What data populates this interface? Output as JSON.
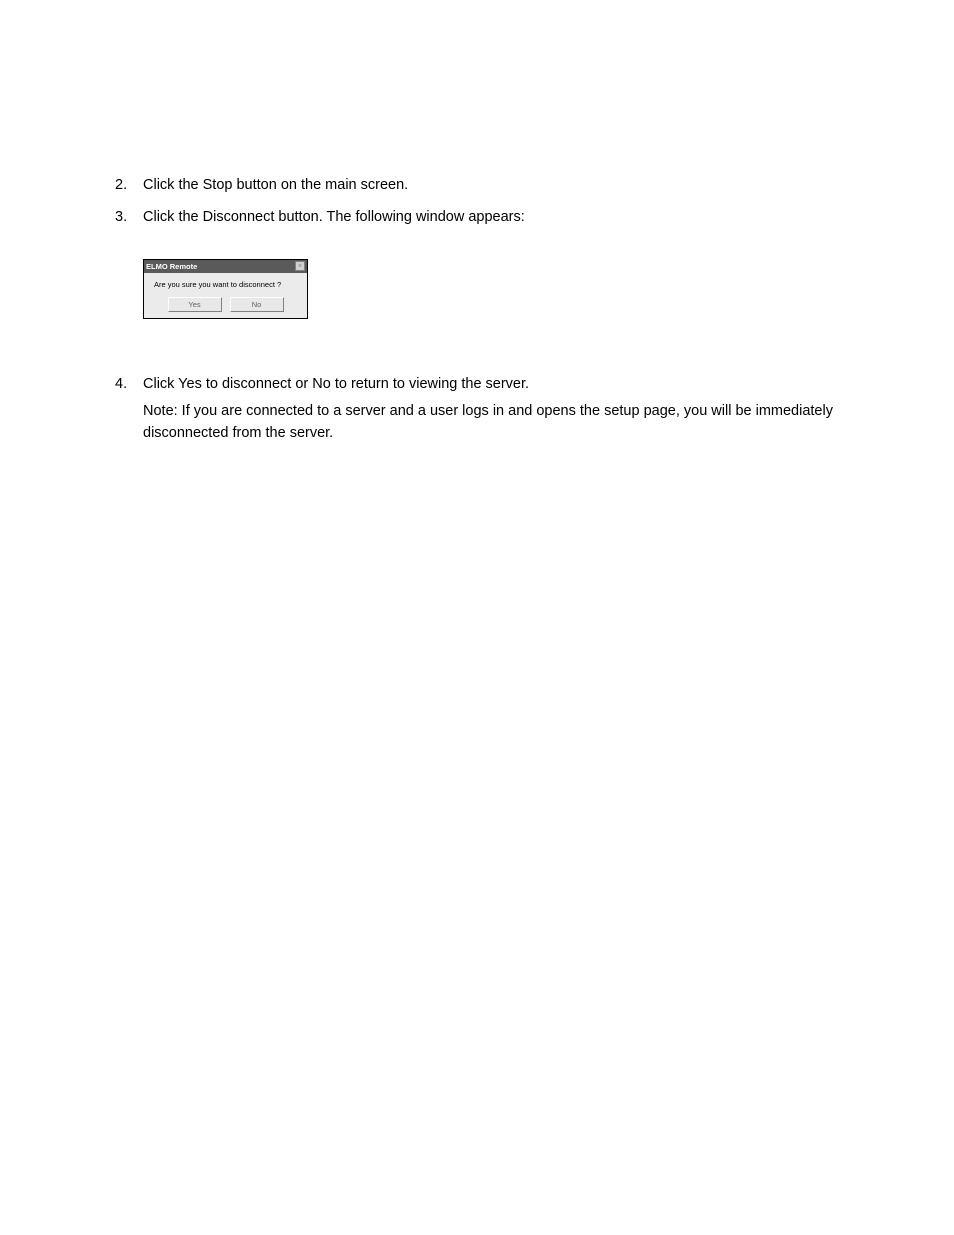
{
  "steps": {
    "step2": {
      "number": "2.",
      "text": "Click the Stop button on the main screen."
    },
    "step3": {
      "number": "3.",
      "text": "Click the Disconnect button. The following window appears:"
    },
    "step4": {
      "number": "4.",
      "text": "Click Yes to disconnect or No to return to viewing the server.",
      "note": "Note: If you are connected to a server and a user logs in and opens the setup page, you will be immediately disconnected from the server."
    }
  },
  "dialog": {
    "title": "ELMO Remote",
    "close": "×",
    "message": "Are you sure you want to disconnect ?",
    "yes": "Yes",
    "no": "No"
  }
}
